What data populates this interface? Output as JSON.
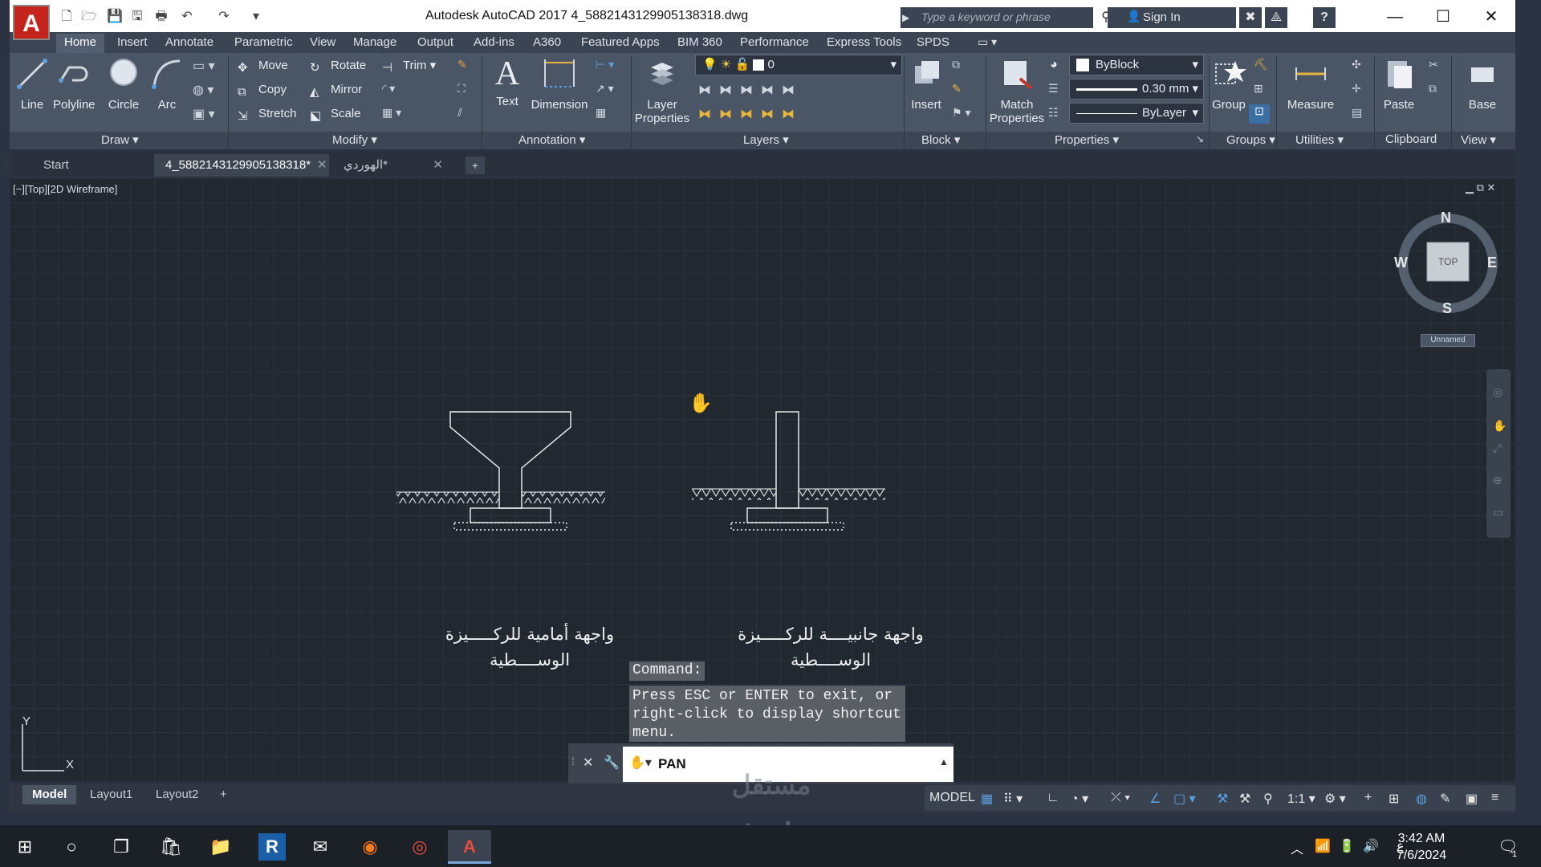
{
  "window": {
    "app_initial": "A",
    "title": "Autodesk AutoCAD 2017    4_5882143129905138318.dwg",
    "search_placeholder": "Type a keyword or phrase",
    "signin_label": "Sign In",
    "help": "?",
    "minimize": "—",
    "maximize": "☐",
    "close": "✕"
  },
  "ribbon_tabs": [
    "Home",
    "Insert",
    "Annotate",
    "Parametric",
    "View",
    "Manage",
    "Output",
    "Add-ins",
    "A360",
    "Featured Apps",
    "BIM 360",
    "Performance",
    "Express Tools",
    "SPDS"
  ],
  "ribbon": {
    "draw": {
      "line": "Line",
      "polyline": "Polyline",
      "circle": "Circle",
      "arc": "Arc",
      "panel": "Draw ▾"
    },
    "modify": {
      "move": "Move",
      "rotate": "Rotate",
      "trim": "Trim",
      "copy": "Copy",
      "mirror": "Mirror",
      "stretch": "Stretch",
      "scale": "Scale",
      "panel": "Modify ▾"
    },
    "annotation": {
      "text": "Text",
      "dimension": "Dimension",
      "panel": "Annotation ▾"
    },
    "layers": {
      "layer_properties": "Layer Properties",
      "current_layer": "0",
      "panel": "Layers ▾"
    },
    "block": {
      "insert": "Insert",
      "panel": "Block ▾"
    },
    "properties": {
      "match": "Match Properties",
      "color": "ByBlock",
      "lineweight": "0.30 mm",
      "linetype": "ByLayer",
      "panel": "Properties ▾"
    },
    "groups": {
      "group": "Group",
      "panel": "Groups ▾"
    },
    "utilities": {
      "measure": "Measure",
      "panel": "Utilities ▾"
    },
    "clipboard": {
      "paste": "Paste",
      "panel": "Clipboard"
    },
    "view": {
      "base": "Base",
      "panel": "View ▾"
    }
  },
  "file_tabs": [
    {
      "label": "Start"
    },
    {
      "label": "4_5882143129905138318*"
    },
    {
      "label": "الهوردي*"
    }
  ],
  "viewport": {
    "label": "[−][Top][2D Wireframe]",
    "viewcube": {
      "n": "N",
      "s": "S",
      "e": "E",
      "w": "W",
      "face": "TOP",
      "ucs": "Unnamed"
    },
    "ucs_y": "Y",
    "ucs_x": "X"
  },
  "drawing_text": {
    "front_line1": "واجهة أمامية للركـــــيزة",
    "front_line2": "الوســــطية",
    "side_line1": "واجهة جانبيــــة للركـــــيزة",
    "side_line2": "الوســــطية"
  },
  "command": {
    "history_label": "Command:",
    "history_message": "Press ESC or ENTER to exit, or right-click to display shortcut menu.",
    "current": "PAN"
  },
  "layout_tabs": [
    "Model",
    "Layout1",
    "Layout2"
  ],
  "status": {
    "model": "MODEL",
    "scale": "1:1"
  },
  "taskbar": {
    "time": "3:42 AM",
    "date": "7/6/2024",
    "lang": "ع",
    "notif_count": "1"
  },
  "watermark": "mostaql.com"
}
